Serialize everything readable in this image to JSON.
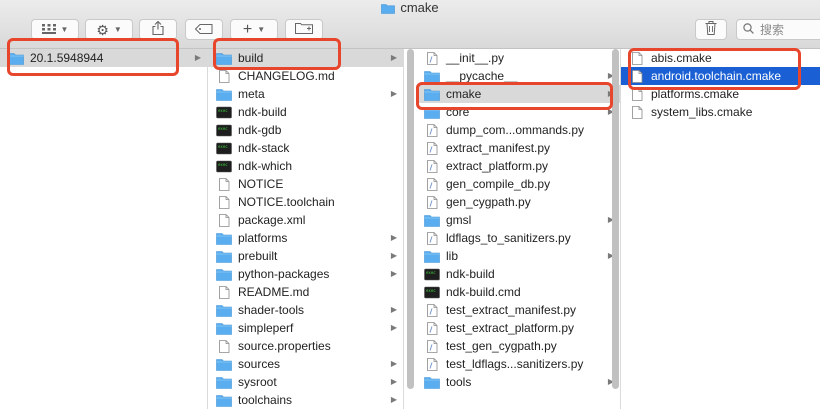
{
  "window": {
    "title": "cmake"
  },
  "toolbar": {
    "search_placeholder": "搜索"
  },
  "columns": [
    {
      "items": [
        {
          "label": "20.1.5948944",
          "type": "folder",
          "arrow": true,
          "selected": "gray"
        }
      ]
    },
    {
      "items": [
        {
          "label": "build",
          "type": "folder",
          "arrow": true,
          "selected": "gray"
        },
        {
          "label": "CHANGELOG.md",
          "type": "doc",
          "arrow": false
        },
        {
          "label": "meta",
          "type": "folder",
          "arrow": true
        },
        {
          "label": "ndk-build",
          "type": "exec",
          "arrow": false
        },
        {
          "label": "ndk-gdb",
          "type": "exec",
          "arrow": false
        },
        {
          "label": "ndk-stack",
          "type": "exec",
          "arrow": false
        },
        {
          "label": "ndk-which",
          "type": "exec",
          "arrow": false
        },
        {
          "label": "NOTICE",
          "type": "doc",
          "arrow": false
        },
        {
          "label": "NOTICE.toolchain",
          "type": "doc",
          "arrow": false
        },
        {
          "label": "package.xml",
          "type": "doc",
          "arrow": false
        },
        {
          "label": "platforms",
          "type": "folder",
          "arrow": true
        },
        {
          "label": "prebuilt",
          "type": "folder",
          "arrow": true
        },
        {
          "label": "python-packages",
          "type": "folder",
          "arrow": true
        },
        {
          "label": "README.md",
          "type": "doc",
          "arrow": false
        },
        {
          "label": "shader-tools",
          "type": "folder",
          "arrow": true
        },
        {
          "label": "simpleperf",
          "type": "folder",
          "arrow": true
        },
        {
          "label": "source.properties",
          "type": "doc",
          "arrow": false
        },
        {
          "label": "sources",
          "type": "folder",
          "arrow": true
        },
        {
          "label": "sysroot",
          "type": "folder",
          "arrow": true
        },
        {
          "label": "toolchains",
          "type": "folder",
          "arrow": true
        }
      ]
    },
    {
      "items": [
        {
          "label": "__init__.py",
          "type": "py",
          "arrow": false
        },
        {
          "label": "__pycache__",
          "type": "folder",
          "arrow": true
        },
        {
          "label": "cmake",
          "type": "folder",
          "arrow": true,
          "selected": "gray"
        },
        {
          "label": "core",
          "type": "folder",
          "arrow": true
        },
        {
          "label": "dump_com...ommands.py",
          "type": "py",
          "arrow": false
        },
        {
          "label": "extract_manifest.py",
          "type": "py",
          "arrow": false
        },
        {
          "label": "extract_platform.py",
          "type": "py",
          "arrow": false
        },
        {
          "label": "gen_compile_db.py",
          "type": "py",
          "arrow": false
        },
        {
          "label": "gen_cygpath.py",
          "type": "py",
          "arrow": false
        },
        {
          "label": "gmsl",
          "type": "folder",
          "arrow": true
        },
        {
          "label": "ldflags_to_sanitizers.py",
          "type": "py",
          "arrow": false
        },
        {
          "label": "lib",
          "type": "folder",
          "arrow": true
        },
        {
          "label": "ndk-build",
          "type": "exec",
          "arrow": false
        },
        {
          "label": "ndk-build.cmd",
          "type": "exec",
          "arrow": false
        },
        {
          "label": "test_extract_manifest.py",
          "type": "py",
          "arrow": false
        },
        {
          "label": "test_extract_platform.py",
          "type": "py",
          "arrow": false
        },
        {
          "label": "test_gen_cygpath.py",
          "type": "py",
          "arrow": false
        },
        {
          "label": "test_ldflags...sanitizers.py",
          "type": "py",
          "arrow": false
        },
        {
          "label": "tools",
          "type": "folder",
          "arrow": true
        }
      ]
    },
    {
      "items": [
        {
          "label": "abis.cmake",
          "type": "doc",
          "arrow": false
        },
        {
          "label": "android.toolchain.cmake",
          "type": "doc",
          "arrow": false,
          "selected": "blue"
        },
        {
          "label": "platforms.cmake",
          "type": "doc",
          "arrow": false
        },
        {
          "label": "system_libs.cmake",
          "type": "doc",
          "arrow": false
        }
      ]
    }
  ],
  "colors": {
    "selection_blue": "#1a60d4",
    "selection_gray": "#d9d9d9",
    "folder": "#5aaef0",
    "highlight": "#e8452d"
  }
}
